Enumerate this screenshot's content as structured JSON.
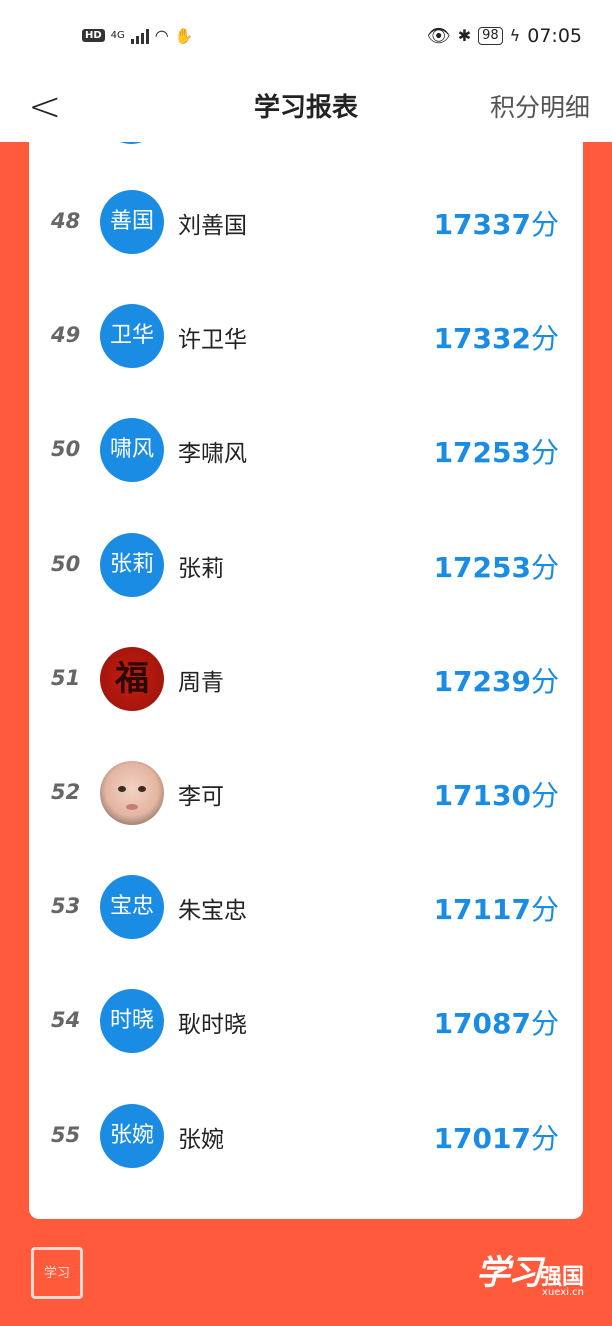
{
  "status_bar": {
    "hd": "HD",
    "network": "4G",
    "battery": "98",
    "time": "07:05"
  },
  "nav": {
    "back": "<",
    "title": "学习报表",
    "detail": "积分明细"
  },
  "rankings": [
    {
      "rank": "48",
      "avatar_text": "善国",
      "name": "刘善国",
      "score": "17337",
      "unit": "分",
      "avatar_type": "text"
    },
    {
      "rank": "49",
      "avatar_text": "卫华",
      "name": "许卫华",
      "score": "17332",
      "unit": "分",
      "avatar_type": "text"
    },
    {
      "rank": "50",
      "avatar_text": "啸风",
      "name": "李啸风",
      "score": "17253",
      "unit": "分",
      "avatar_type": "text"
    },
    {
      "rank": "50",
      "avatar_text": "张莉",
      "name": "张莉",
      "score": "17253",
      "unit": "分",
      "avatar_type": "text"
    },
    {
      "rank": "51",
      "avatar_text": "福",
      "name": "周青",
      "score": "17239",
      "unit": "分",
      "avatar_type": "fu-photo"
    },
    {
      "rank": "52",
      "avatar_text": "",
      "name": "李可",
      "score": "17130",
      "unit": "分",
      "avatar_type": "baby-photo"
    },
    {
      "rank": "53",
      "avatar_text": "宝忠",
      "name": "朱宝忠",
      "score": "17117",
      "unit": "分",
      "avatar_type": "text"
    },
    {
      "rank": "54",
      "avatar_text": "时晓",
      "name": "耿时晓",
      "score": "17087",
      "unit": "分",
      "avatar_type": "text"
    },
    {
      "rank": "55",
      "avatar_text": "张婉",
      "name": "张婉",
      "score": "17017",
      "unit": "分",
      "avatar_type": "text"
    }
  ],
  "footer": {
    "seal": "学习",
    "logo_script": "学习",
    "logo_text": "强国",
    "logo_url": "xuexi.cn"
  },
  "colors": {
    "accent_blue": "#1b8ce3",
    "background_red": "#ff5a3c"
  }
}
